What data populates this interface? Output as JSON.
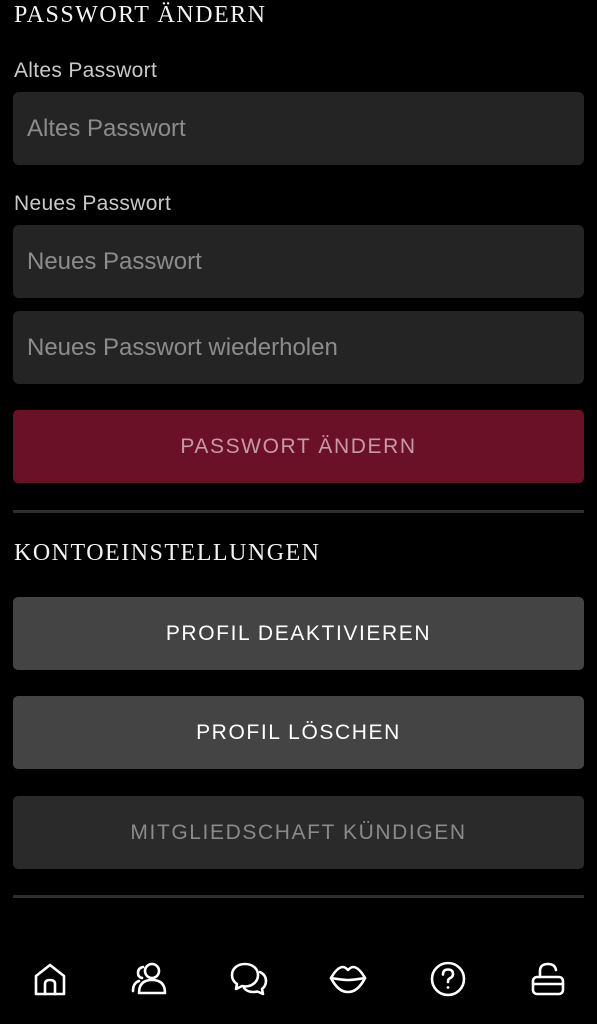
{
  "password_section": {
    "title": "PASSWORT ÄNDERN",
    "old_label": "Altes Passwort",
    "old_placeholder": "Altes Passwort",
    "new_label": "Neues Passwort",
    "new_placeholder": "Neues Passwort",
    "repeat_placeholder": "Neues Passwort wiederholen",
    "submit_label": "PASSWORT ÄNDERN"
  },
  "account_section": {
    "title": "KONTOEINSTELLUNGEN",
    "deactivate_label": "PROFIL DEAKTIVIEREN",
    "delete_label": "PROFIL LÖSCHEN",
    "cancel_membership_label": "MITGLIEDSCHAFT KÜNDIGEN"
  },
  "colors": {
    "background": "#000000",
    "input_bg": "#242424",
    "primary_button": "#6b1127",
    "primary_button_text": "#c69aa5",
    "secondary_button": "#444444",
    "secondary_button_text": "#ffffff",
    "disabled_button": "#2a2a2a",
    "disabled_button_text": "#8a8a8a"
  },
  "bottom_nav": {
    "items": [
      {
        "icon": "home-icon"
      },
      {
        "icon": "users-icon"
      },
      {
        "icon": "chat-icon"
      },
      {
        "icon": "lips-icon"
      },
      {
        "icon": "help-icon"
      },
      {
        "icon": "unlock-icon"
      }
    ]
  }
}
